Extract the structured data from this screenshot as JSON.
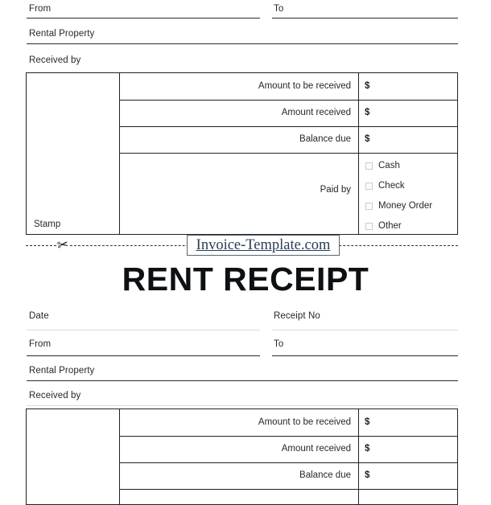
{
  "document": {
    "type": "rent-receipt-template",
    "title": "RENT RECEIPT",
    "watermark": "Invoice-Template.com",
    "cut_line_icon": "scissors-icon"
  },
  "receipt_top": {
    "fields": {
      "from": "From",
      "to": "To",
      "rental_property": "Rental Property",
      "received_by": "Received by"
    },
    "stamp_label": "Stamp",
    "amount_rows": [
      {
        "label": "Amount to be received",
        "currency": "$",
        "value": ""
      },
      {
        "label": "Amount received",
        "currency": "$",
        "value": ""
      },
      {
        "label": "Balance due",
        "currency": "$",
        "value": ""
      }
    ],
    "paid_by": {
      "label": "Paid by",
      "options": [
        "Cash",
        "Check",
        "Money Order",
        "Other"
      ]
    }
  },
  "receipt_bottom": {
    "fields": {
      "date": "Date",
      "receipt_no": "Receipt No",
      "from": "From",
      "to": "To",
      "rental_property": "Rental Property",
      "received_by": "Received by"
    },
    "amount_rows": [
      {
        "label": "Amount to be received",
        "currency": "$",
        "value": ""
      },
      {
        "label": "Amount received",
        "currency": "$",
        "value": ""
      },
      {
        "label": "Balance due",
        "currency": "$",
        "value": ""
      }
    ]
  },
  "colors": {
    "rule_dark": "#262b2f",
    "rule_light": "#d8dcdf",
    "table_border": "#1d2226",
    "checkbox_border": "#c3ced6",
    "watermark_text": "#2a3d57",
    "title_text": "#0e1113"
  }
}
